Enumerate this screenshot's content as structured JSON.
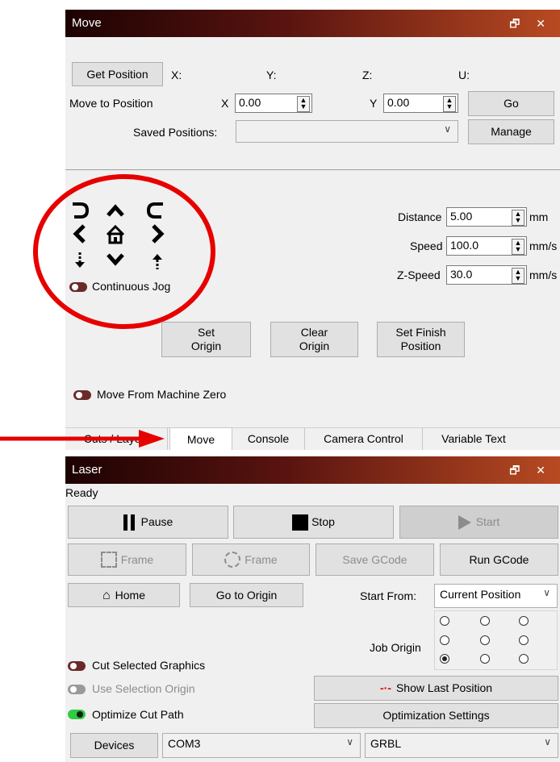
{
  "move_panel": {
    "title": "Move",
    "title_icons": "🗗 ✕",
    "get_position": "Get Position",
    "coords": {
      "x": "X:",
      "y": "Y:",
      "z": "Z:",
      "u": "U:"
    },
    "move_to_position": "Move to Position",
    "x_label": "X",
    "x_value": "0.00",
    "y_label": "Y",
    "y_value": "0.00",
    "go": "Go",
    "saved_positions_label": "Saved Positions:",
    "saved_positions_value": "",
    "manage": "Manage",
    "distance_label": "Distance",
    "distance_value": "5.00",
    "distance_unit": "mm",
    "speed_label": "Speed",
    "speed_value": "100.0",
    "speed_unit": "mm/s",
    "zspeed_label": "Z-Speed",
    "zspeed_value": "30.0",
    "zspeed_unit": "mm/s",
    "continuous_jog": "Continuous Jog",
    "set_origin": "Set\nOrigin",
    "clear_origin": "Clear\nOrigin",
    "set_finish": "Set Finish\nPosition",
    "move_from_zero": "Move From Machine Zero"
  },
  "tabs": [
    {
      "label": "Cuts / Layers"
    },
    {
      "label": "Move"
    },
    {
      "label": "Console"
    },
    {
      "label": "Camera Control"
    },
    {
      "label": "Variable Text"
    }
  ],
  "laser_panel": {
    "title": "Laser",
    "title_icons": "🗗 ✕",
    "status": "Ready",
    "pause": "Pause",
    "stop": "Stop",
    "start": "Start",
    "frame1": "Frame",
    "frame2": "Frame",
    "save_gcode": "Save GCode",
    "run_gcode": "Run GCode",
    "home": "Home",
    "go_to_origin": "Go to Origin",
    "start_from_label": "Start From:",
    "start_from_value": "Current Position",
    "job_origin_label": "Job Origin",
    "cut_selected": "Cut Selected Graphics",
    "use_selection_origin": "Use Selection Origin",
    "optimize_cut_path": "Optimize Cut Path",
    "show_last_position": "Show Last Position",
    "optimization_settings": "Optimization Settings",
    "devices": "Devices",
    "port": "COM3",
    "controller": "GRBL"
  },
  "colors": {
    "annotation_red": "#e60000",
    "toggle_on": "#2ecc40",
    "toggle_off": "#6b2a2a"
  }
}
